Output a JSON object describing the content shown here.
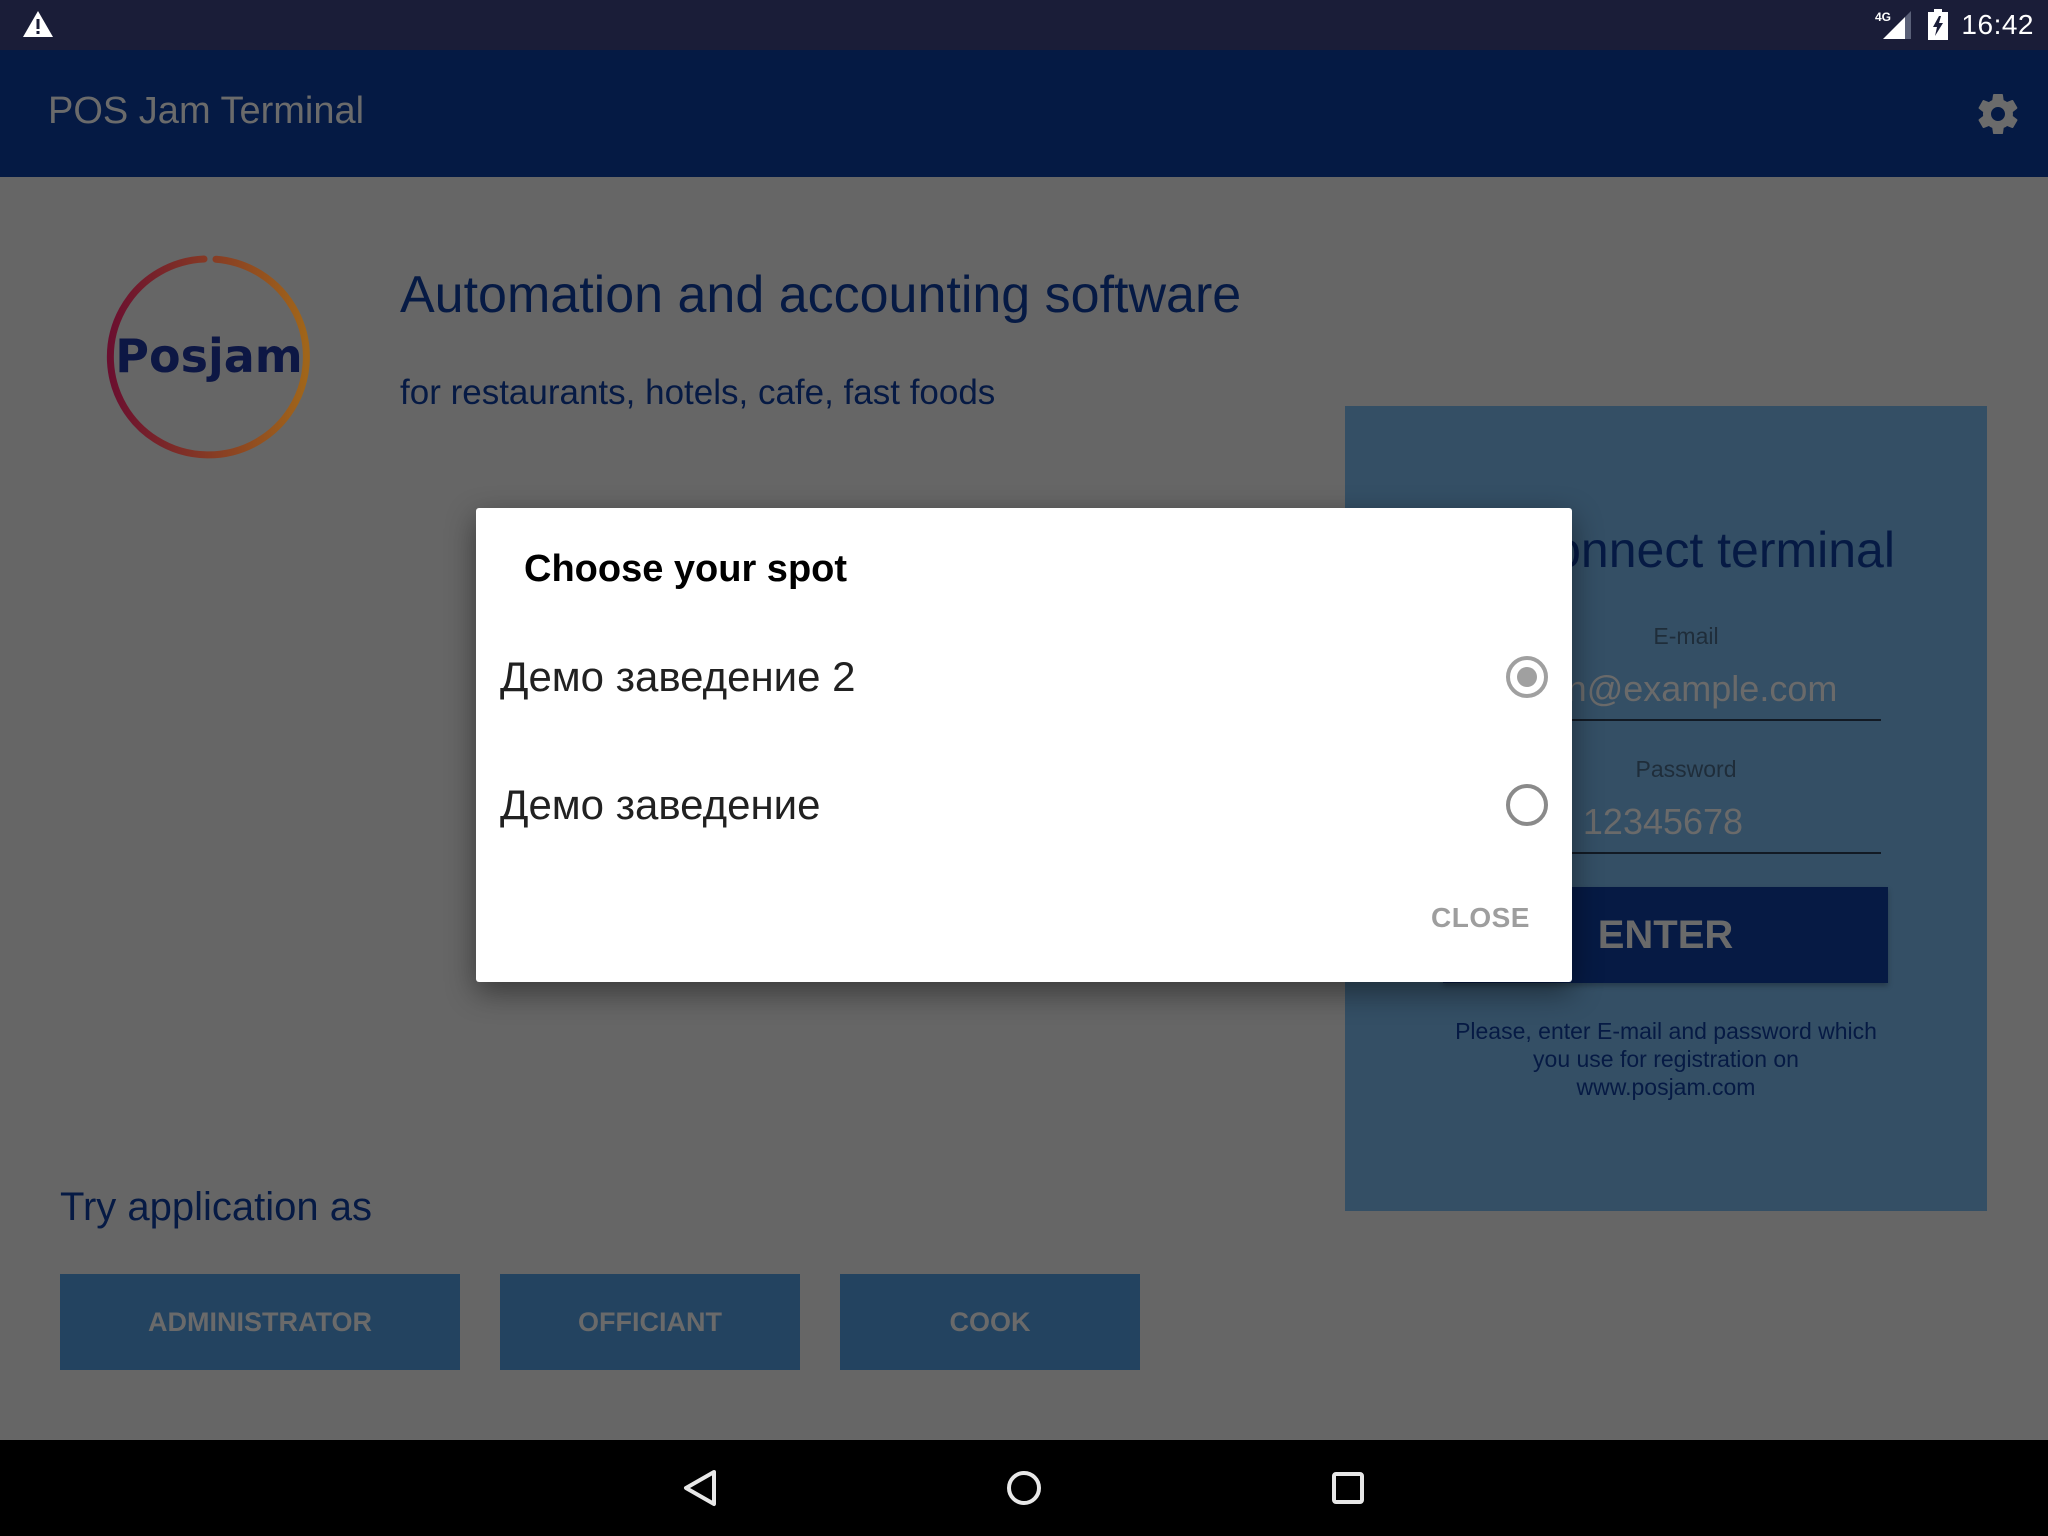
{
  "status_bar": {
    "time": "16:42",
    "network": "4G",
    "icons": [
      "warning-icon",
      "signal-icon",
      "battery-charging-icon"
    ]
  },
  "app_bar": {
    "title": "POS Jam Terminal",
    "settings_icon": "gear-icon"
  },
  "hero": {
    "logo_text": "Posjam",
    "headline": "Automation and accounting software",
    "subline": "for restaurants, hotels, cafe, fast foods"
  },
  "login": {
    "title": "Connect terminal",
    "email_label": "E-mail",
    "email_placeholder": "admin@example.com",
    "password_label": "Password",
    "password_placeholder": "12345678",
    "enter_label": "ENTER",
    "hint": "Please, enter E-mail and password which you use for registration on www.posjam.com"
  },
  "try_as": {
    "label": "Try application as",
    "roles": [
      "ADMINISTRATOR",
      "OFFICIANT",
      "COOK"
    ]
  },
  "dialog": {
    "title": "Choose your spot",
    "options": [
      {
        "label": "Демо заведение 2",
        "selected": true
      },
      {
        "label": "Демо заведение",
        "selected": false
      }
    ],
    "close_label": "CLOSE"
  },
  "nav_bar": {
    "buttons": [
      "back-icon",
      "home-icon",
      "recents-icon"
    ]
  },
  "colors": {
    "status_bar": "#1a1d38",
    "app_bar": "#051a44",
    "scrim_background": "#666666",
    "login_panel": "#344f65",
    "enter_button": "#061a44",
    "role_button": "#234360",
    "logo_gradient_start": "#6b0f2f",
    "logo_gradient_end": "#a0651a"
  }
}
